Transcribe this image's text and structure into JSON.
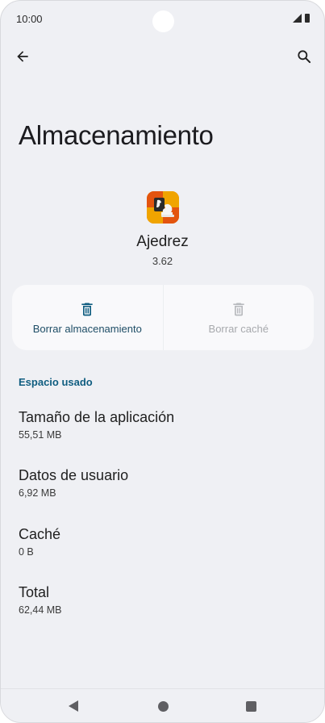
{
  "status_bar": {
    "time": "10:00"
  },
  "toolbar": {
    "back_icon": "arrow-back-icon",
    "search_icon": "search-icon"
  },
  "page": {
    "title": "Almacenamiento"
  },
  "app": {
    "name": "Ajedrez",
    "version": "3.62",
    "icon": "chess-app-icon"
  },
  "actions": {
    "clear_storage_label": "Borrar almacenamiento",
    "clear_storage_enabled": true,
    "clear_cache_label": "Borrar caché",
    "clear_cache_enabled": false
  },
  "section": {
    "header": "Espacio usado"
  },
  "storage_items": [
    {
      "title": "Tamaño de la aplicación",
      "value": "55,51 MB"
    },
    {
      "title": "Datos de usuario",
      "value": "6,92 MB"
    },
    {
      "title": "Caché",
      "value": "0 B"
    },
    {
      "title": "Total",
      "value": "62,44 MB"
    }
  ],
  "colors": {
    "background": "#eff0f4",
    "accent": "#0f5d80",
    "card": "#f9f9fb",
    "disabled": "#a7a9ad"
  }
}
